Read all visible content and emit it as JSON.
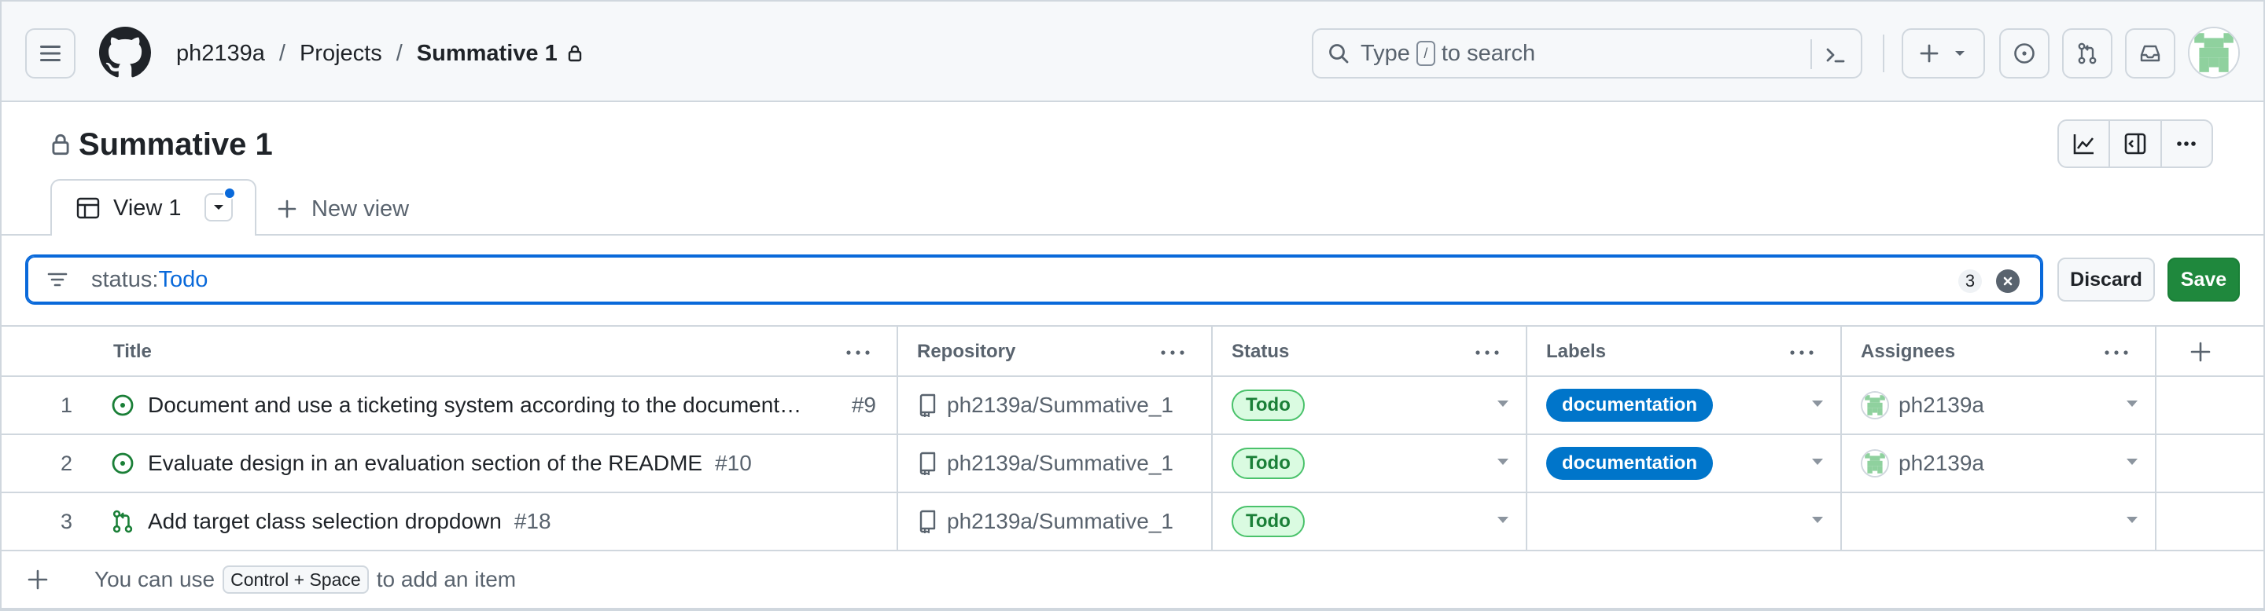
{
  "header": {
    "breadcrumb": {
      "owner": "ph2139a",
      "section": "Projects",
      "project": "Summative 1",
      "sep": "/"
    },
    "search": {
      "prefix": "Type",
      "key": "/",
      "suffix": "to search"
    }
  },
  "project": {
    "title": "Summative 1",
    "tabs": [
      {
        "label": "View 1"
      }
    ],
    "new_view_label": "New view"
  },
  "filter": {
    "key": "status:",
    "value": "Todo",
    "count": "3",
    "discard_label": "Discard",
    "save_label": "Save"
  },
  "table": {
    "columns": [
      "Title",
      "Repository",
      "Status",
      "Labels",
      "Assignees"
    ],
    "rows": [
      {
        "num": "1",
        "type": "issue",
        "title": "Document and use a ticketing system according to the document…",
        "issue": "#9",
        "repo": "ph2139a/Summative_1",
        "status": "Todo",
        "label": "documentation",
        "assignee": "ph2139a"
      },
      {
        "num": "2",
        "type": "issue",
        "title": "Evaluate design in an evaluation section of the README",
        "issue": "#10",
        "repo": "ph2139a/Summative_1",
        "status": "Todo",
        "label": "documentation",
        "assignee": "ph2139a"
      },
      {
        "num": "3",
        "type": "pull-request",
        "title": "Add target class selection dropdown",
        "issue": "#18",
        "repo": "ph2139a/Summative_1",
        "status": "Todo",
        "label": "",
        "assignee": ""
      }
    ],
    "add_hint": {
      "before": "You can use",
      "key": "Control + Space",
      "after": "to add an item"
    }
  },
  "colors": {
    "accent": "#0969da",
    "save": "#1f883d",
    "label_documentation": "#0075ca",
    "status_todo_bg": "#dafbe1",
    "status_todo_fg": "#1a7f37"
  }
}
